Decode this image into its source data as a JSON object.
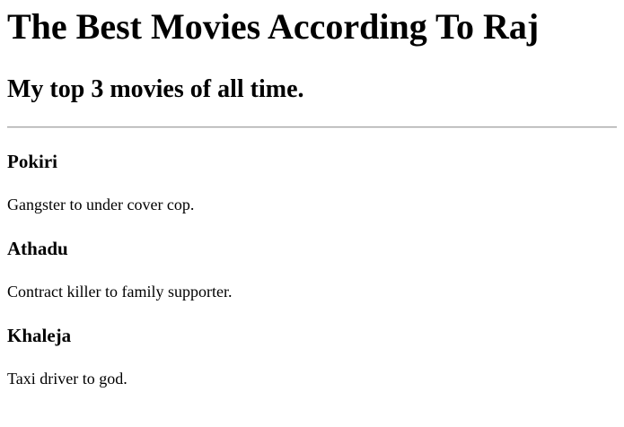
{
  "page": {
    "title": "The Best Movies According To Raj",
    "subtitle": "My top 3 movies of all time."
  },
  "movies": [
    {
      "title": "Pokiri",
      "description": "Gangster to under cover cop."
    },
    {
      "title": "Athadu",
      "description": "Contract killer to family supporter."
    },
    {
      "title": "Khaleja",
      "description": "Taxi driver to god."
    }
  ]
}
